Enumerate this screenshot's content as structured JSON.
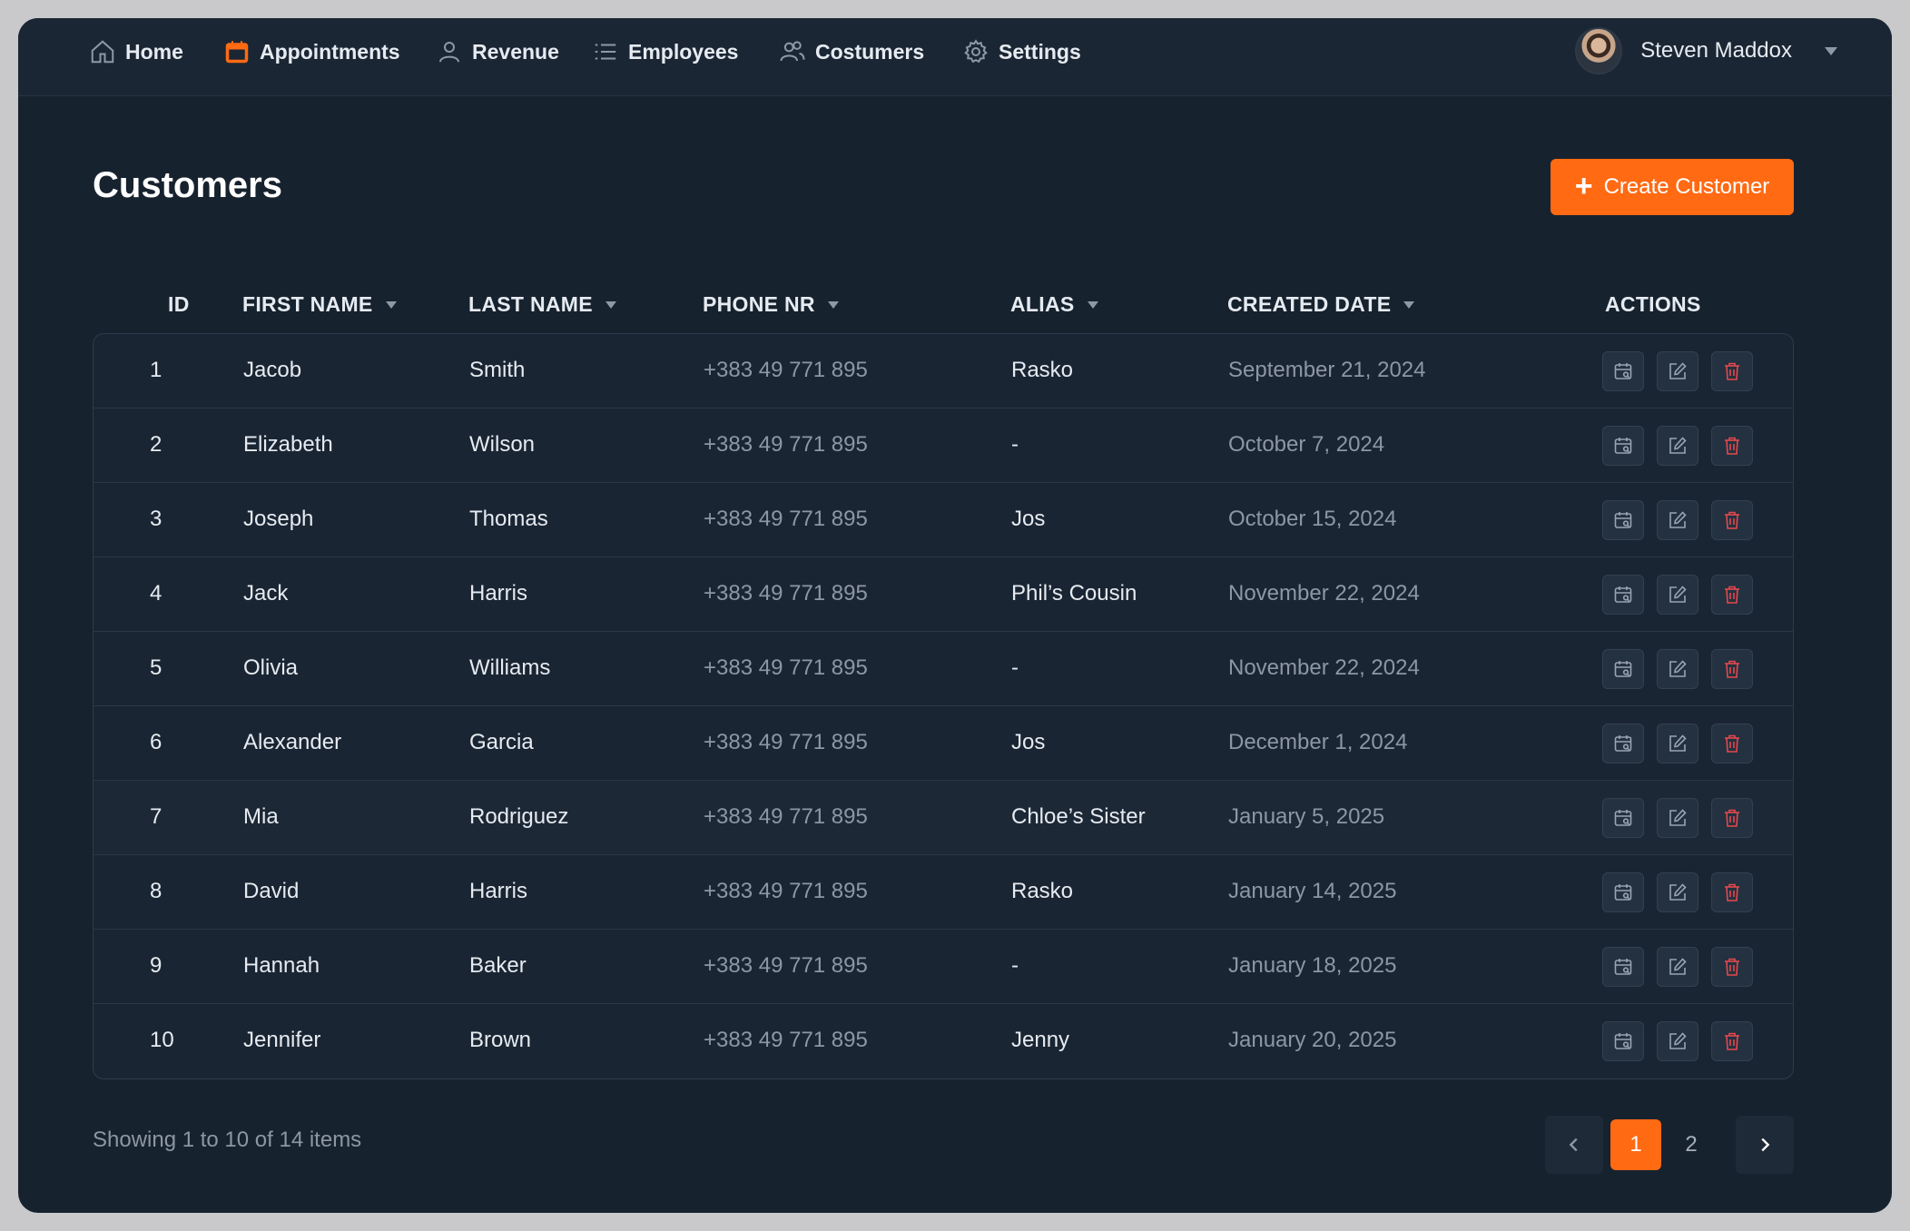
{
  "nav": {
    "items": [
      {
        "label": "Home",
        "icon": "home-icon"
      },
      {
        "label": "Appointments",
        "icon": "calendar-icon",
        "active": true
      },
      {
        "label": "Revenue",
        "icon": "user-icon"
      },
      {
        "label": "Employees",
        "icon": "list-icon"
      },
      {
        "label": "Costumers",
        "icon": "users-icon"
      },
      {
        "label": "Settings",
        "icon": "gear-icon"
      }
    ],
    "user_name": "Steven Maddox"
  },
  "page": {
    "title": "Customers",
    "create_label": "Create Customer"
  },
  "table": {
    "headers": {
      "id": "ID",
      "first_name": "FIRST NAME",
      "last_name": "LAST NAME",
      "phone": "PHONE NR",
      "alias": "ALIAS",
      "created": "CREATED DATE",
      "actions": "ACTIONS"
    },
    "rows": [
      {
        "id": "1",
        "first": "Jacob",
        "last": "Smith",
        "phone": "+383 49 771 895",
        "alias": "Rasko",
        "created": "September 21, 2024"
      },
      {
        "id": "2",
        "first": "Elizabeth",
        "last": "Wilson",
        "phone": "+383 49 771 895",
        "alias": "-",
        "created": "October 7, 2024"
      },
      {
        "id": "3",
        "first": "Joseph",
        "last": "Thomas",
        "phone": "+383 49 771 895",
        "alias": "Jos",
        "created": "October 15, 2024"
      },
      {
        "id": "4",
        "first": "Jack",
        "last": "Harris",
        "phone": "+383 49 771 895",
        "alias": "Phil’s Cousin",
        "created": "November 22, 2024"
      },
      {
        "id": "5",
        "first": "Olivia",
        "last": "Williams",
        "phone": "+383 49 771 895",
        "alias": "-",
        "created": "November 22, 2024"
      },
      {
        "id": "6",
        "first": "Alexander",
        "last": "Garcia",
        "phone": "+383 49 771 895",
        "alias": "Jos",
        "created": "December 1, 2024"
      },
      {
        "id": "7",
        "first": "Mia",
        "last": "Rodriguez",
        "phone": "+383 49 771 895",
        "alias": "Chloe’s Sister",
        "created": "January 5, 2025"
      },
      {
        "id": "8",
        "first": "David",
        "last": "Harris",
        "phone": "+383 49 771 895",
        "alias": "Rasko",
        "created": "January 14, 2025"
      },
      {
        "id": "9",
        "first": "Hannah",
        "last": "Baker",
        "phone": "+383 49 771 895",
        "alias": "-",
        "created": "January 18, 2025"
      },
      {
        "id": "10",
        "first": "Jennifer",
        "last": "Brown",
        "phone": "+383 49 771 895",
        "alias": "Jenny",
        "created": "January 20, 2025"
      }
    ]
  },
  "footer": {
    "showing": "Showing 1 to 10 of 14 items",
    "pages": [
      "1",
      "2"
    ],
    "current_page": "1"
  },
  "colors": {
    "accent": "#ff6a13",
    "danger": "#e5484d",
    "background": "#17222f"
  }
}
